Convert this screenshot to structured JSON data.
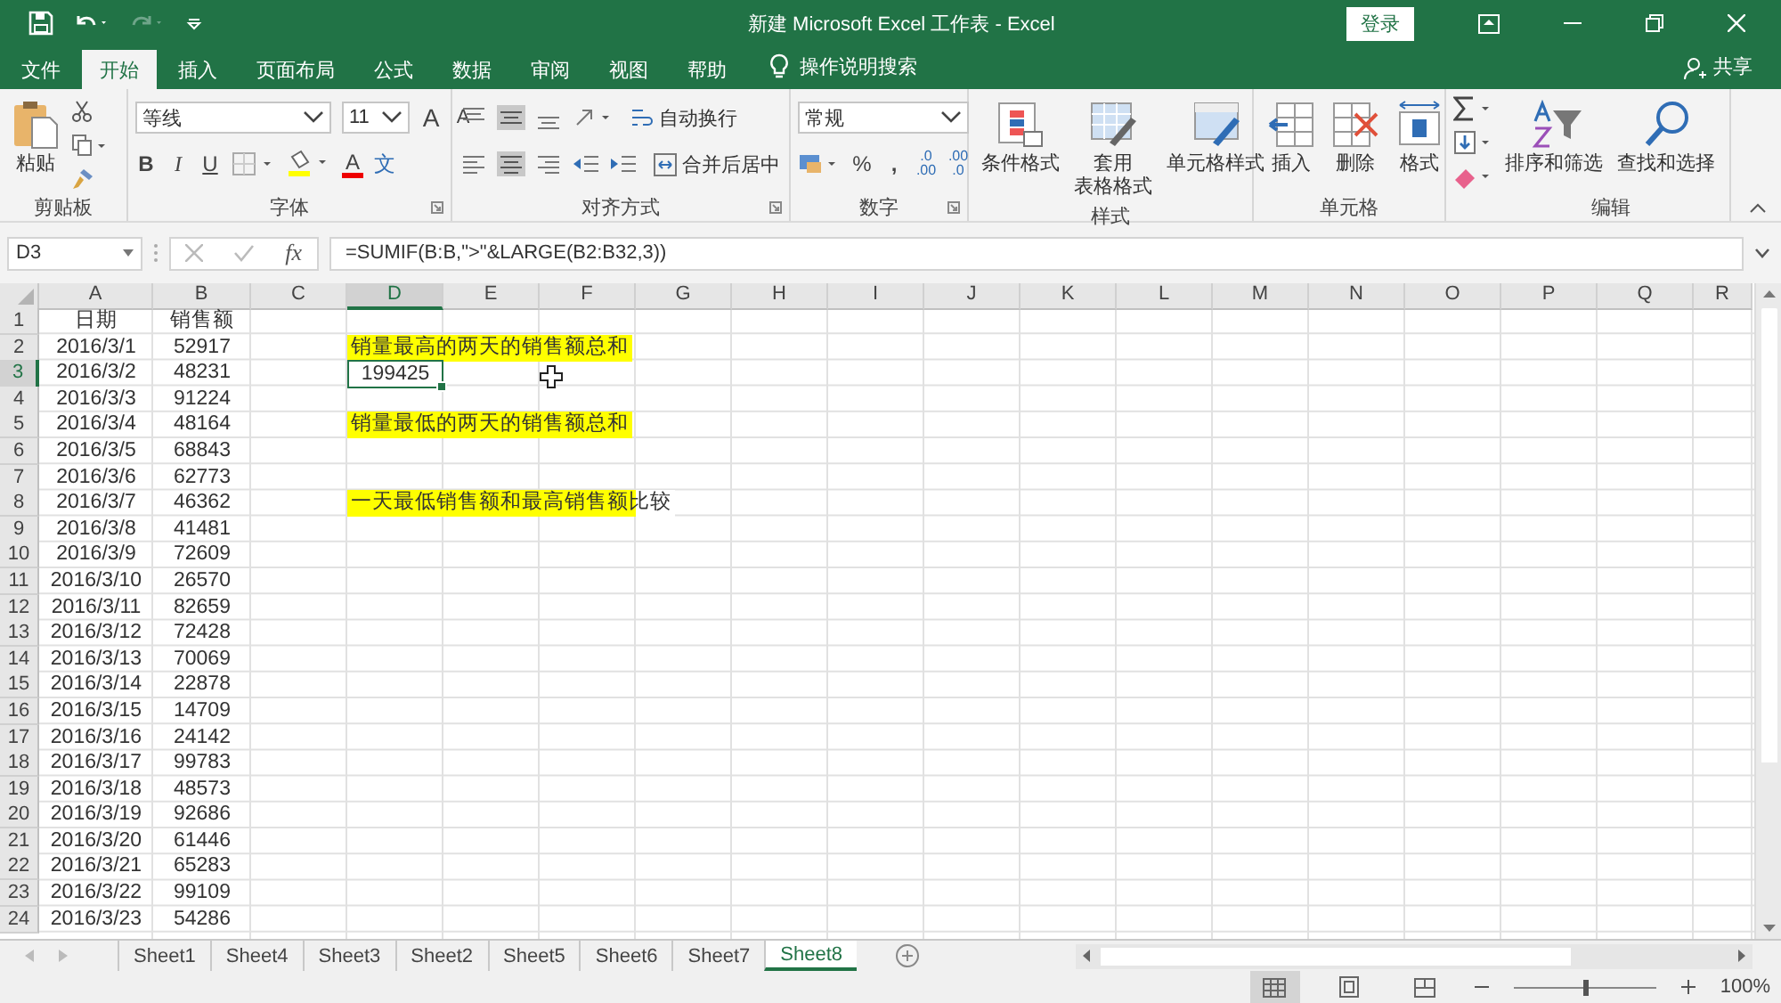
{
  "title_bar": {
    "title": "新建 Microsoft Excel 工作表 - Excel",
    "sign_in": "登录"
  },
  "menu_tabs": [
    {
      "label": "文件",
      "selected": false
    },
    {
      "label": "开始",
      "selected": true
    },
    {
      "label": "插入",
      "selected": false
    },
    {
      "label": "页面布局",
      "selected": false
    },
    {
      "label": "公式",
      "selected": false
    },
    {
      "label": "数据",
      "selected": false
    },
    {
      "label": "审阅",
      "selected": false
    },
    {
      "label": "视图",
      "selected": false
    },
    {
      "label": "帮助",
      "selected": false
    }
  ],
  "tell_me": "操作说明搜索",
  "share": "共享",
  "ribbon": {
    "clipboard": {
      "label": "剪贴板",
      "paste": "粘贴"
    },
    "font": {
      "label": "字体",
      "font_name": "等线",
      "font_size": "11",
      "grow": "A",
      "shrink": "A",
      "bold": "B",
      "italic": "I",
      "underline": "U",
      "font_color": "A",
      "phonetic": "文"
    },
    "alignment": {
      "label": "对齐方式",
      "wrap_text": "自动换行",
      "merge_center": "合并后居中"
    },
    "number": {
      "label": "数字",
      "format": "常规",
      "percent": "%",
      "comma": ",",
      "increase_decimal": [
        ".0",
        ".00"
      ],
      "decrease_decimal": [
        ".00",
        ".0"
      ]
    },
    "styles": {
      "label": "样式",
      "buttons": [
        {
          "kind": "conditional",
          "lines": [
            "条件格式"
          ]
        },
        {
          "kind": "table",
          "lines": [
            "套用",
            "表格格式"
          ]
        },
        {
          "kind": "cell",
          "lines": [
            "单元格样式"
          ]
        }
      ]
    },
    "cells": {
      "label": "单元格",
      "buttons": [
        {
          "kind": "insert",
          "lines": [
            "插入"
          ]
        },
        {
          "kind": "delete",
          "lines": [
            "删除"
          ]
        },
        {
          "kind": "format",
          "lines": [
            "格式"
          ]
        }
      ]
    },
    "editing": {
      "label": "编辑",
      "buttons": [
        {
          "kind": "sort",
          "lines": [
            "排序和筛选"
          ]
        },
        {
          "kind": "find",
          "lines": [
            "查找和选择"
          ]
        }
      ]
    }
  },
  "formula_bar": {
    "name_box": "D3",
    "fx": "fx",
    "formula": "=SUMIF(B:B,\">\"&LARGE(B2:B32,3))"
  },
  "columns": [
    {
      "label": "A",
      "selected": false
    },
    {
      "label": "B",
      "selected": false
    },
    {
      "label": "C",
      "selected": false
    },
    {
      "label": "D",
      "selected": true
    },
    {
      "label": "E",
      "selected": false
    },
    {
      "label": "F",
      "selected": false
    },
    {
      "label": "G",
      "selected": false
    },
    {
      "label": "H",
      "selected": false
    },
    {
      "label": "I",
      "selected": false
    },
    {
      "label": "J",
      "selected": false
    },
    {
      "label": "K",
      "selected": false
    },
    {
      "label": "L",
      "selected": false
    },
    {
      "label": "M",
      "selected": false
    },
    {
      "label": "N",
      "selected": false
    },
    {
      "label": "O",
      "selected": false
    },
    {
      "label": "P",
      "selected": false
    },
    {
      "label": "Q",
      "selected": false
    },
    {
      "label": "R",
      "selected": false
    }
  ],
  "rows": [
    {
      "number": "1",
      "date": "日期",
      "sales": "销售额",
      "note": "",
      "selected": false,
      "highlighted": false
    },
    {
      "number": "2",
      "date": "2016/3/1",
      "sales": "52917",
      "note": "销量最高的两天的销售额总和",
      "selected": false,
      "highlighted": true
    },
    {
      "number": "3",
      "date": "2016/3/2",
      "sales": "48231",
      "note": "199425",
      "selected": true,
      "highlighted": false
    },
    {
      "number": "4",
      "date": "2016/3/3",
      "sales": "91224",
      "note": "",
      "selected": false,
      "highlighted": false
    },
    {
      "number": "5",
      "date": "2016/3/4",
      "sales": "48164",
      "note": "销量最低的两天的销售额总和",
      "selected": false,
      "highlighted": true
    },
    {
      "number": "6",
      "date": "2016/3/5",
      "sales": "68843",
      "note": "",
      "selected": false,
      "highlighted": false
    },
    {
      "number": "7",
      "date": "2016/3/6",
      "sales": "62773",
      "note": "",
      "selected": false,
      "highlighted": false
    },
    {
      "number": "8",
      "date": "2016/3/7",
      "sales": "46362",
      "note": "一天最低销售额和最高销售额比较",
      "selected": false,
      "highlighted": true
    },
    {
      "number": "9",
      "date": "2016/3/8",
      "sales": "41481",
      "note": "",
      "selected": false,
      "highlighted": false
    },
    {
      "number": "10",
      "date": "2016/3/9",
      "sales": "72609",
      "note": "",
      "selected": false,
      "highlighted": false
    },
    {
      "number": "11",
      "date": "2016/3/10",
      "sales": "26570",
      "note": "",
      "selected": false,
      "highlighted": false
    },
    {
      "number": "12",
      "date": "2016/3/11",
      "sales": "82659",
      "note": "",
      "selected": false,
      "highlighted": false
    },
    {
      "number": "13",
      "date": "2016/3/12",
      "sales": "72428",
      "note": "",
      "selected": false,
      "highlighted": false
    },
    {
      "number": "14",
      "date": "2016/3/13",
      "sales": "70069",
      "note": "",
      "selected": false,
      "highlighted": false
    },
    {
      "number": "15",
      "date": "2016/3/14",
      "sales": "22878",
      "note": "",
      "selected": false,
      "highlighted": false
    },
    {
      "number": "16",
      "date": "2016/3/15",
      "sales": "14709",
      "note": "",
      "selected": false,
      "highlighted": false
    },
    {
      "number": "17",
      "date": "2016/3/16",
      "sales": "24142",
      "note": "",
      "selected": false,
      "highlighted": false
    },
    {
      "number": "18",
      "date": "2016/3/17",
      "sales": "99783",
      "note": "",
      "selected": false,
      "highlighted": false
    },
    {
      "number": "19",
      "date": "2016/3/18",
      "sales": "48573",
      "note": "",
      "selected": false,
      "highlighted": false
    },
    {
      "number": "20",
      "date": "2016/3/19",
      "sales": "92686",
      "note": "",
      "selected": false,
      "highlighted": false
    },
    {
      "number": "21",
      "date": "2016/3/20",
      "sales": "61446",
      "note": "",
      "selected": false,
      "highlighted": false
    },
    {
      "number": "22",
      "date": "2016/3/21",
      "sales": "65283",
      "note": "",
      "selected": false,
      "highlighted": false
    },
    {
      "number": "23",
      "date": "2016/3/22",
      "sales": "99109",
      "note": "",
      "selected": false,
      "highlighted": false
    },
    {
      "number": "24",
      "date": "2016/3/23",
      "sales": "54286",
      "note": "",
      "selected": false,
      "highlighted": false
    }
  ],
  "sheet_tabs": [
    {
      "label": "Sheet1",
      "selected": false
    },
    {
      "label": "Sheet4",
      "selected": false
    },
    {
      "label": "Sheet3",
      "selected": false
    },
    {
      "label": "Sheet2",
      "selected": false
    },
    {
      "label": "Sheet5",
      "selected": false
    },
    {
      "label": "Sheet6",
      "selected": false
    },
    {
      "label": "Sheet7",
      "selected": false
    },
    {
      "label": "Sheet8",
      "selected": true
    }
  ],
  "status_bar": {
    "views": [
      {
        "kind": "normal",
        "selected": true
      },
      {
        "kind": "page_layout",
        "selected": false
      },
      {
        "kind": "page_break",
        "selected": false
      }
    ],
    "zoom_slider": {
      "level": 0.5
    },
    "zoom": "100%"
  }
}
